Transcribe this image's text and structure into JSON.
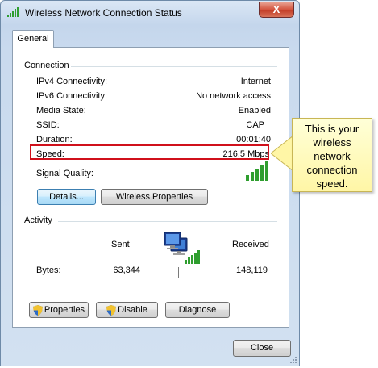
{
  "window": {
    "title": "Wireless Network Connection Status",
    "close_glyph": "X"
  },
  "tabs": [
    {
      "label": "General"
    }
  ],
  "connection": {
    "heading": "Connection",
    "rows": [
      {
        "label": "IPv4 Connectivity:",
        "value": "Internet"
      },
      {
        "label": "IPv6 Connectivity:",
        "value": "No network access"
      },
      {
        "label": "Media State:",
        "value": "Enabled"
      },
      {
        "label": "SSID:",
        "value": "CAP"
      },
      {
        "label": "Duration:",
        "value": "00:01:40"
      },
      {
        "label": "Speed:",
        "value": "216.5 Mbps"
      }
    ],
    "signal_label": "Signal Quality:",
    "signal_bars_active": 5,
    "signal_bars_total": 5,
    "details_button": "Details...",
    "wireless_properties_button": "Wireless Properties"
  },
  "activity": {
    "heading": "Activity",
    "sent_label": "Sent",
    "received_label": "Received",
    "bytes_label": "Bytes:",
    "bytes_sent": "63,344",
    "bytes_received": "148,119",
    "properties_button": "Properties",
    "disable_button": "Disable",
    "diagnose_button": "Diagnose"
  },
  "close_button": "Close",
  "callout": {
    "lines": [
      "This is your",
      "wireless",
      "network",
      "connection",
      "speed."
    ]
  },
  "colors": {
    "highlight_border": "#d0101b",
    "callout_fill": "#fff6a6",
    "signal_green": "#2f9e2f"
  },
  "icons": [
    "wireless-signal-icon",
    "network-computer-icon",
    "uac-shield-icon",
    "close-icon"
  ]
}
